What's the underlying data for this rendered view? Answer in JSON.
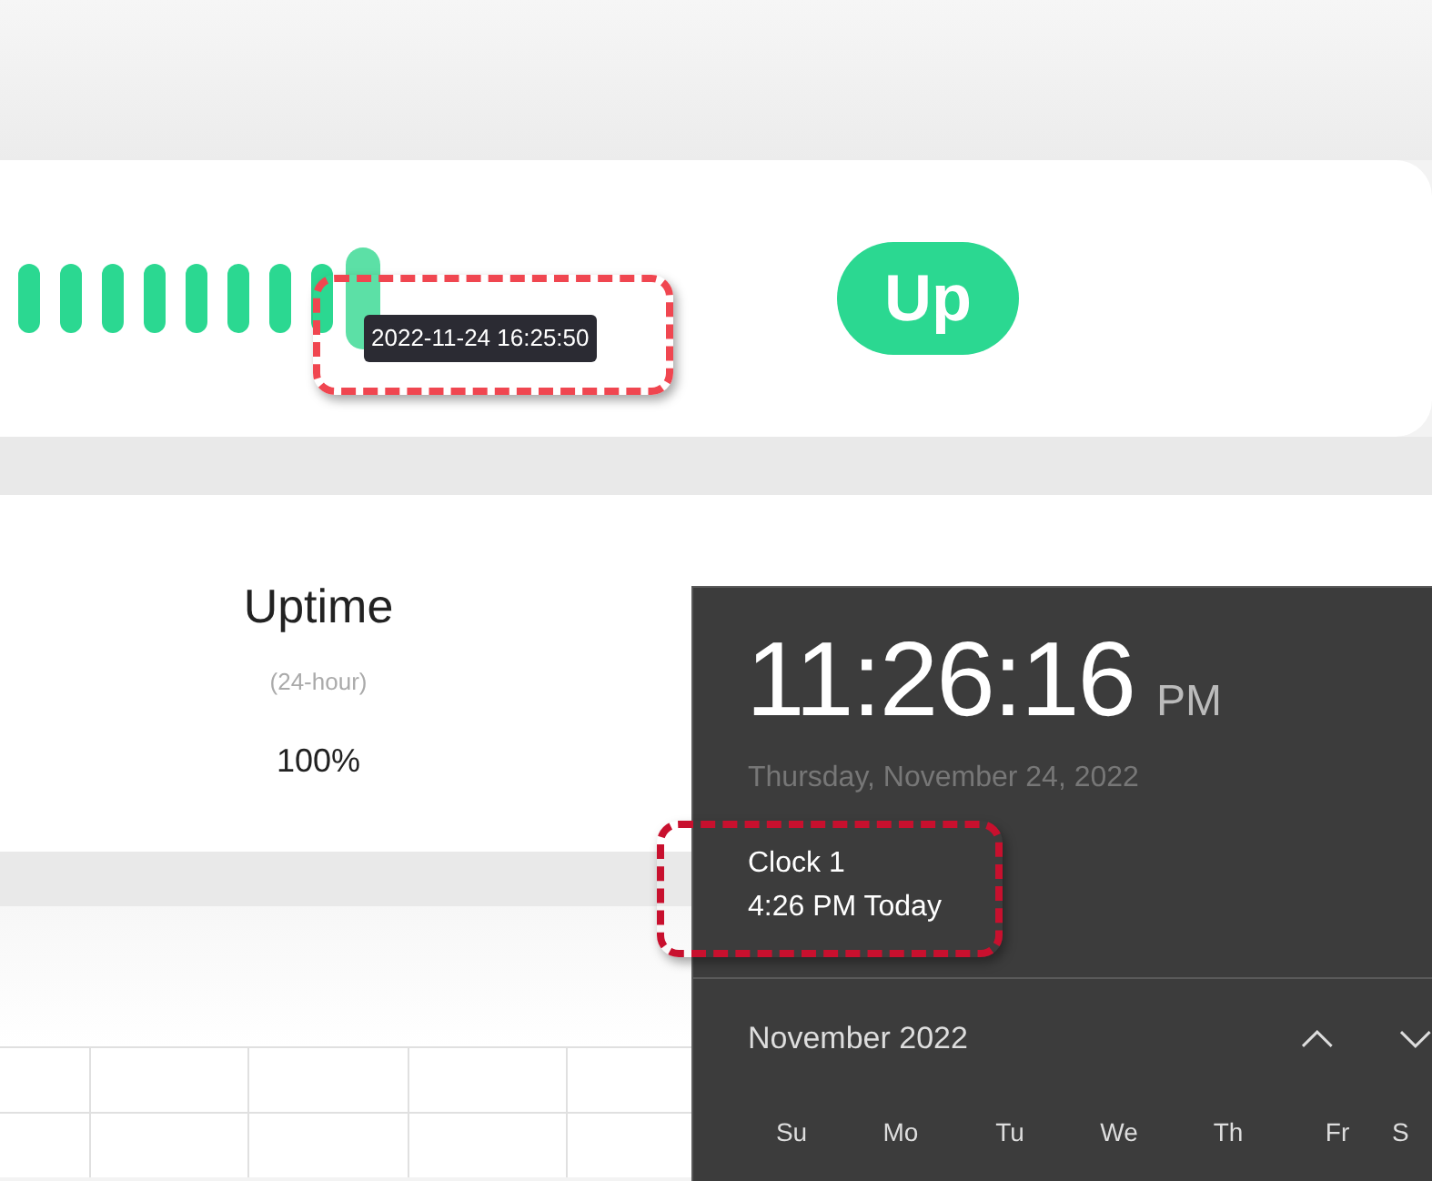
{
  "heartbeat_bar": {
    "beats": [
      {
        "color": "#2bd891",
        "selected": false
      },
      {
        "color": "#2bd891",
        "selected": false
      },
      {
        "color": "#2bd891",
        "selected": false
      },
      {
        "color": "#2bd891",
        "selected": false
      },
      {
        "color": "#2bd891",
        "selected": false
      },
      {
        "color": "#2bd891",
        "selected": false
      },
      {
        "color": "#2bd891",
        "selected": false
      },
      {
        "color": "#2bd891",
        "selected": false
      },
      {
        "color": "#5ce0a6",
        "selected": true
      }
    ],
    "tooltip": "2022-11-24 16:25:50",
    "status_badge": {
      "label": "Up",
      "color": "#2bd891"
    }
  },
  "stats": [
    {
      "title": "Uptime",
      "subtitle": "(24-hour)",
      "value": "100%"
    }
  ],
  "clock_flyout": {
    "time": "11:26:16",
    "ampm": "PM",
    "date": "Thursday, November 24, 2022",
    "clocks": [
      {
        "name": "Clock 1",
        "time": "4:26 PM Today"
      }
    ],
    "month": "November 2022",
    "weekdays": [
      "Su",
      "Mo",
      "Tu",
      "We",
      "Th",
      "Fr",
      "S"
    ]
  },
  "annotations": [
    {
      "kind": "dashed-box",
      "color": "#f04650"
    },
    {
      "kind": "dashed-box",
      "color": "#c8102e"
    }
  ]
}
